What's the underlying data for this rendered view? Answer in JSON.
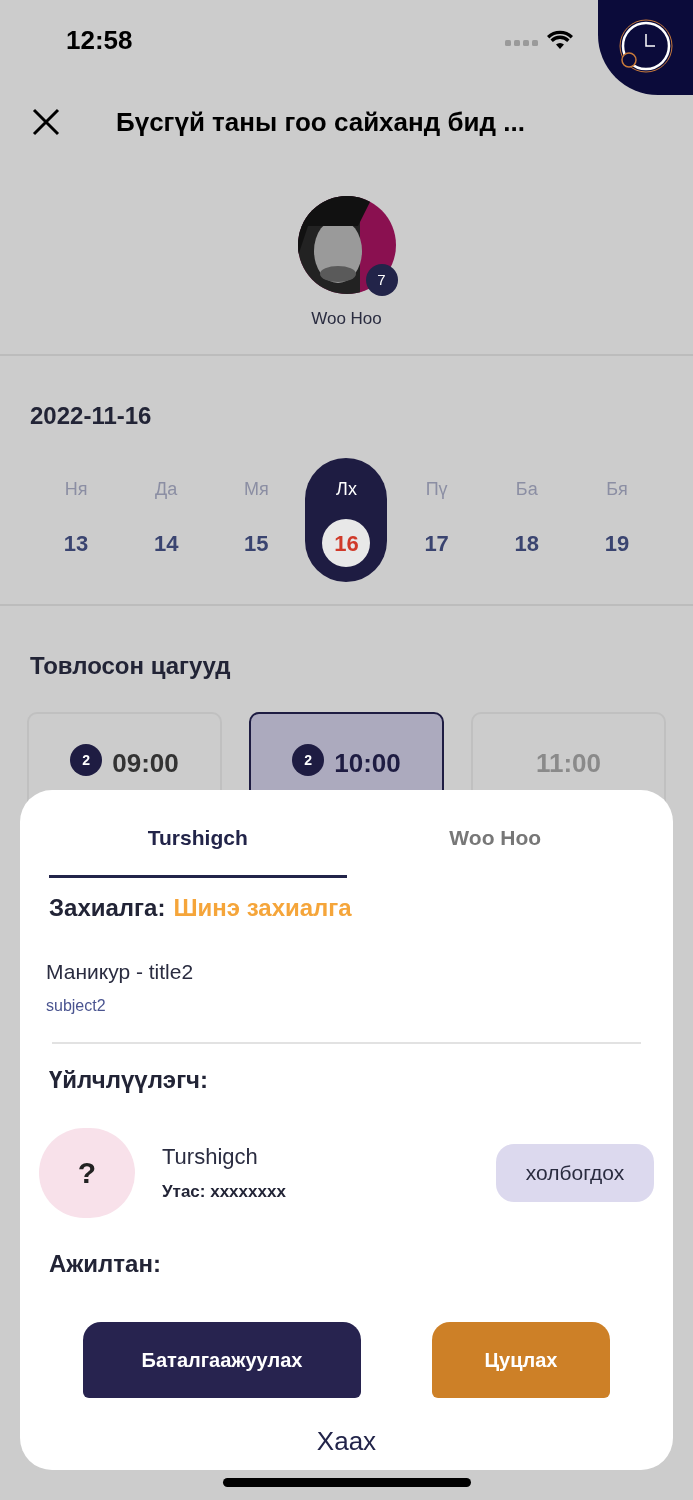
{
  "status_bar": {
    "time": "12:58"
  },
  "header": {
    "title": "Бүсгүй таны гоо сайханд бид ..."
  },
  "specialist": {
    "name": "Woo Hoo",
    "badge": "7"
  },
  "date": "2022-11-16",
  "days": [
    {
      "label": "Ня",
      "day": "13",
      "selected": false
    },
    {
      "label": "Да",
      "day": "14",
      "selected": false
    },
    {
      "label": "Мя",
      "day": "15",
      "selected": false
    },
    {
      "label": "Лх",
      "day": "16",
      "selected": true
    },
    {
      "label": "Пү",
      "day": "17",
      "selected": false
    },
    {
      "label": "Ба",
      "day": "18",
      "selected": false
    },
    {
      "label": "Бя",
      "day": "19",
      "selected": false
    }
  ],
  "slots_heading": "Товлосон цагууд",
  "slots": [
    {
      "time": "09:00",
      "count": "2",
      "selected": false,
      "disabled": false
    },
    {
      "time": "10:00",
      "count": "2",
      "selected": true,
      "disabled": false
    },
    {
      "time": "11:00",
      "selected": false,
      "disabled": true
    }
  ],
  "sheet": {
    "tabs": [
      {
        "label": "Turshigch",
        "selected": true
      },
      {
        "label": "Woo Hoo",
        "selected": false
      }
    ],
    "order_label": "Захиалга:",
    "order_status": "Шинэ захиалга",
    "service": "Маникур - title2",
    "subject": "subject2",
    "customer_heading": "Үйлчлүүлэгч:",
    "customer": {
      "avatar": "?",
      "name": "Turshigch",
      "phone": "Утас: xxxxxxxx",
      "contact_button": "холбогдох"
    },
    "employee_heading": "Ажилтан:",
    "confirm_button": "Баталгаажуулах",
    "cancel_button": "Цуцлах",
    "close_link": "Хаах"
  }
}
